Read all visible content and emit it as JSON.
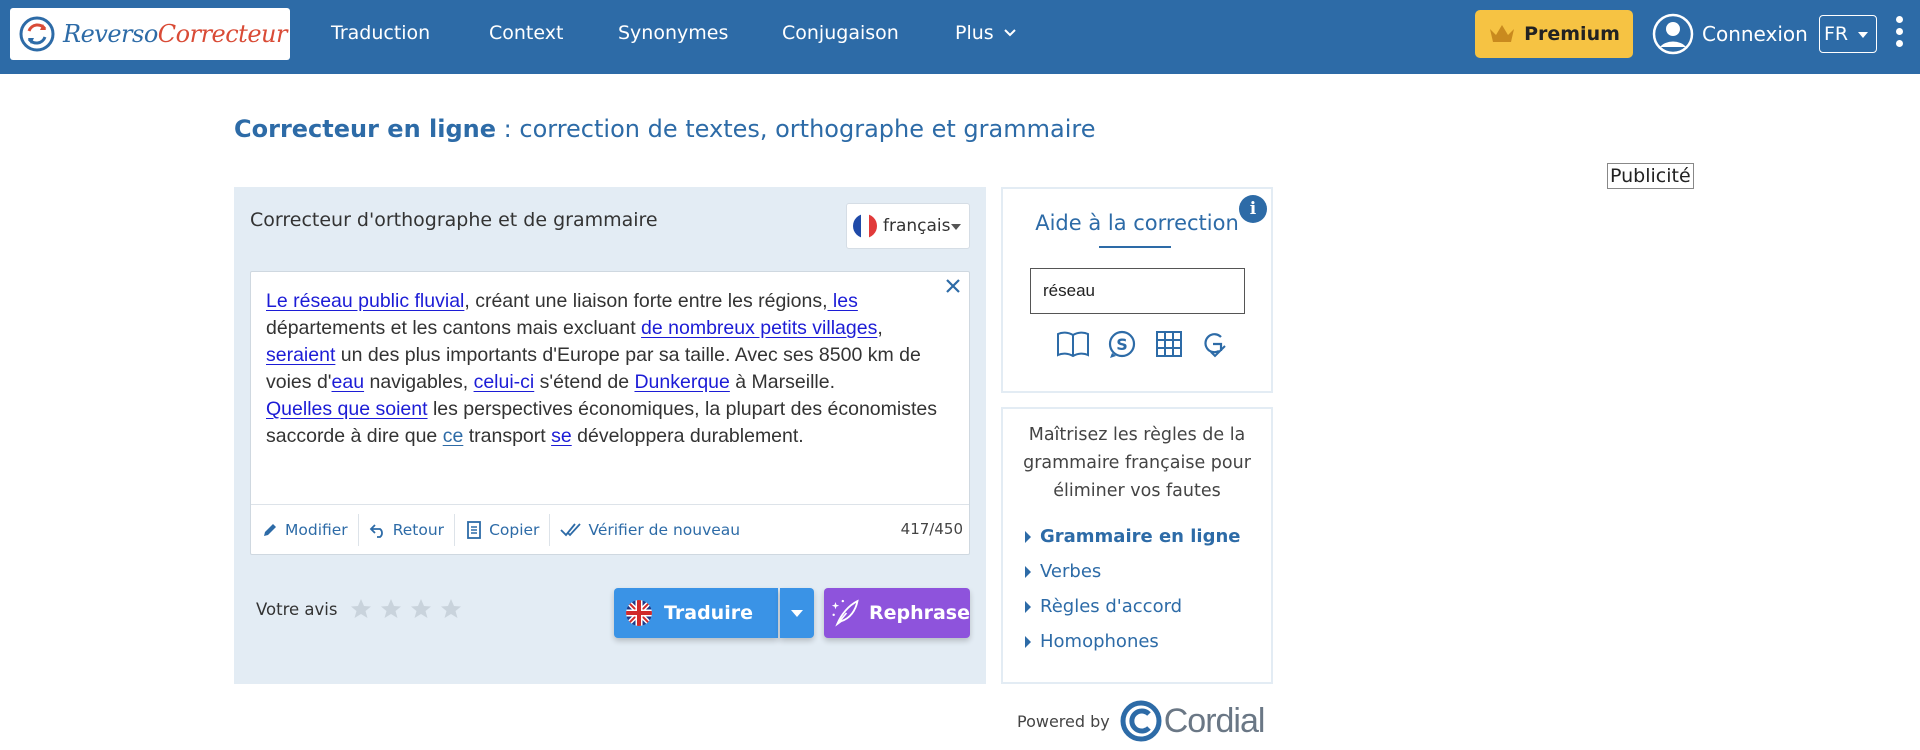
{
  "header": {
    "logo_part1": "Reverso",
    "logo_part2": "Correcteur",
    "nav": [
      "Traduction",
      "Context",
      "Synonymes",
      "Conjugaison",
      "Plus"
    ],
    "premium_label": "Premium",
    "login_label": "Connexion",
    "lang_code": "FR"
  },
  "page": {
    "title_strong": "Correcteur en ligne",
    "title_rest": " : correction de textes, orthographe et grammaire",
    "ad_label": "Publicité"
  },
  "checker": {
    "panel_title": "Correcteur d'orthographe et de grammaire",
    "language": "français",
    "text": {
      "s1": "Le réseau public fluvial",
      "s2": ", créant une liaison forte entre les régions,",
      "s3": " les",
      "s4": " départements et les cantons mais excluant ",
      "s5": "de nombreux petits villages",
      "s6": ", ",
      "s7": "seraient",
      "s8": " un des plus importants d'Europe par sa taille. Avec ses 8500 km de voies d'",
      "s9": "eau",
      "s10": " navigables, ",
      "s11": "celui-ci",
      "s12": " s'étend de ",
      "s13": "Dunkerque",
      "s14": " à Marseille.",
      "s15": "Quelles que soient",
      "s16": " les perspectives économiques, la plupart des économistes saccorde à dire que ",
      "s17": "ce",
      "s18": " transport ",
      "s19": "se",
      "s20": " développera durablement."
    },
    "toolbar": {
      "modify": "Modifier",
      "back": "Retour",
      "copy": "Copier",
      "recheck": "Vérifier de nouveau",
      "counter": "417/450"
    },
    "rating_label": "Votre avis",
    "translate_label": "Traduire",
    "rephrase_label": "Rephrase"
  },
  "aide": {
    "title": "Aide à la correction",
    "info": "i",
    "input_value": "réseau",
    "icons": [
      "book-icon",
      "synonym-icon",
      "table-icon",
      "grammar-check-icon"
    ]
  },
  "grammar": {
    "description": "Maîtrisez les règles de la grammaire française pour éliminer vos fautes",
    "links": [
      "Grammaire en ligne",
      "Verbes",
      "Règles d'accord",
      "Homophones"
    ]
  },
  "footer": {
    "powered_by": "Powered by",
    "brand": "Cordial"
  },
  "colors": {
    "header_bg": "#2d6ba7",
    "premium": "#f6c343",
    "translate": "#3a93e6",
    "rephrase": "#8e53dc",
    "panel_bg": "#e3ecf4"
  }
}
